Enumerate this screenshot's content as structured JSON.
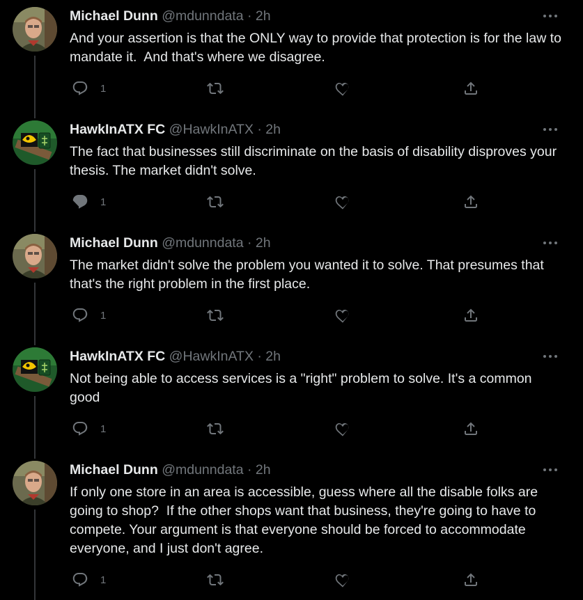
{
  "tweets": [
    {
      "name": "Michael Dunn",
      "handle": "@mdunndata",
      "separator": "·",
      "time": "2h",
      "text": "And your assertion is that the ONLY way to provide that protection is for the law to mandate it.  And that's where we disagree.",
      "reply_count": "1",
      "avatar": "avatar-man-photo"
    },
    {
      "name": "HawkInATX FC",
      "handle": "@HawkInATX",
      "separator": "·",
      "time": "2h",
      "text": "The fact that businesses still discriminate on the basis of disability disproves your thesis. The market didn't solve.",
      "reply_count": "1",
      "avatar": "avatar-hawkeye-logo"
    },
    {
      "name": "Michael Dunn",
      "handle": "@mdunndata",
      "separator": "·",
      "time": "2h",
      "text": "The market didn't solve the problem you wanted it to solve. That presumes that that's the right problem in the first place.",
      "reply_count": "1",
      "avatar": "avatar-man-photo"
    },
    {
      "name": "HawkInATX FC",
      "handle": "@HawkInATX",
      "separator": "·",
      "time": "2h",
      "text": "Not being able to access services is a \"right\" problem to solve. It's a common good",
      "reply_count": "1",
      "avatar": "avatar-hawkeye-logo"
    },
    {
      "name": "Michael Dunn",
      "handle": "@mdunndata",
      "separator": "·",
      "time": "2h",
      "text": "If only one store in an area is accessible, guess where all the disable folks are going to shop?  If the other shops want that business, they're going to have to compete. Your argument is that everyone should be forced to accommodate everyone, and I just don't agree.",
      "reply_count": "1",
      "avatar": "avatar-man-photo"
    }
  ],
  "icons": {
    "reply": "reply-icon",
    "retweet": "retweet-icon",
    "like": "heart-icon",
    "share": "share-icon",
    "more": "more-icon"
  },
  "colors": {
    "background": "#000000",
    "text": "#e7e9ea",
    "secondary": "#71767b",
    "thread_line": "#333639"
  }
}
